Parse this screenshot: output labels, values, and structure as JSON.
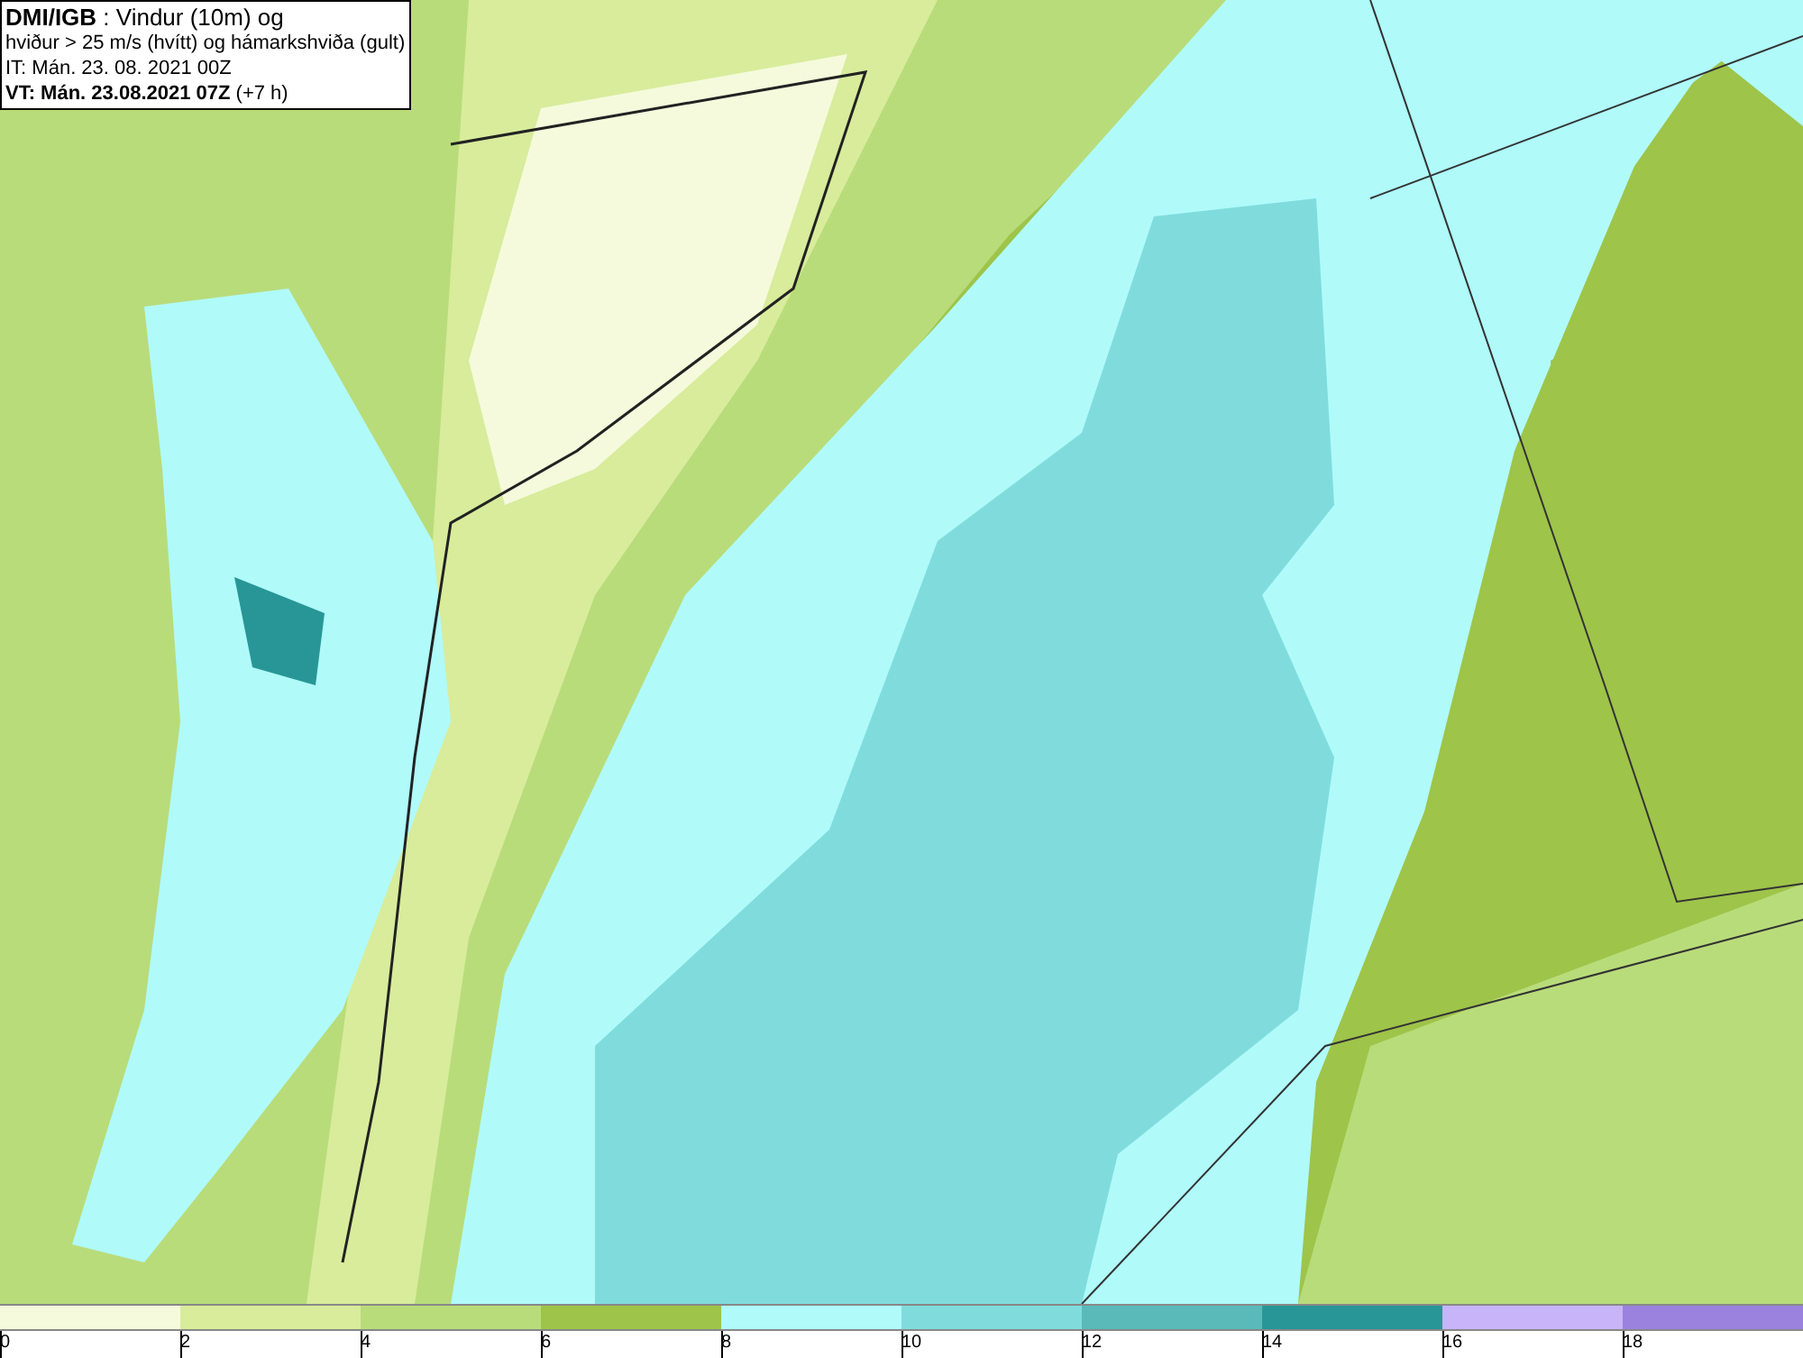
{
  "header": {
    "lines": [
      "**DMI/IGB** : Vindur (10m) og",
      "hviður > 25 m/s (hvítt) og hámarkshviða (gult)",
      "IT: Mán. 23. 08. 2021 00Z",
      "**VT: Mán. 23.08.2021 07Z** (+7 h)"
    ]
  },
  "legend": {
    "bins": [
      {
        "color": "#f5fadc"
      },
      {
        "color": "#d8ec9c"
      },
      {
        "color": "#b9dc7a"
      },
      {
        "color": "#9ec44a"
      },
      {
        "color": "#b0fafa"
      },
      {
        "color": "#80dcdc"
      },
      {
        "color": "#5ab9b9"
      },
      {
        "color": "#289696"
      },
      {
        "color": "#c8b4f8"
      },
      {
        "color": "#9a82de"
      }
    ],
    "ticks": [
      "0",
      "2",
      "4",
      "6",
      "8",
      "10",
      "12",
      "14",
      "16",
      "18"
    ]
  }
}
